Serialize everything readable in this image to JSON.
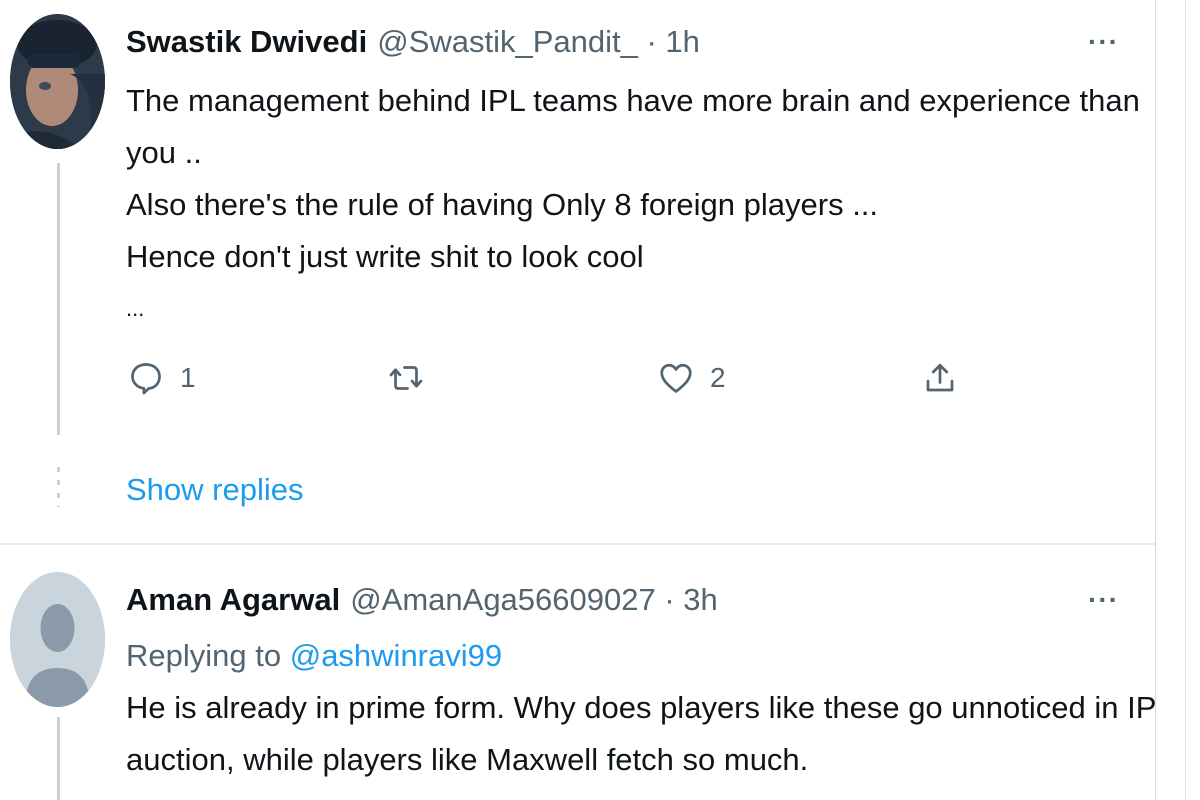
{
  "tweets": [
    {
      "name": "Swastik Dwivedi",
      "handle_time": "@Swastik_Pandit_ · 1h",
      "more": "···",
      "lines": [
        "The management behind IPL teams have more brain and experience than",
        "you ..",
        "Also there's the rule of having Only 8 foreign players ...",
        "Hence don't just write shit to look cool",
        "..."
      ],
      "reply_count": "1",
      "like_count": "2",
      "show_replies": "Show replies",
      "icons": [
        "reply-icon",
        "retweet-icon",
        "like-icon",
        "share-icon"
      ]
    },
    {
      "name": "Aman Agarwal",
      "handle_time": "@AmanAga56609027 · 3h",
      "more": "···",
      "replying_prefix": "Replying to ",
      "replying_handle": "@ashwinravi99",
      "lines": [
        "He is already in prime form. Why does players like these go unnoticed in IPL",
        "auction, while players like Maxwell fetch so much."
      ]
    }
  ],
  "colors": {
    "link": "#1d9bf0",
    "muted": "#536471",
    "text": "#0f1419"
  }
}
